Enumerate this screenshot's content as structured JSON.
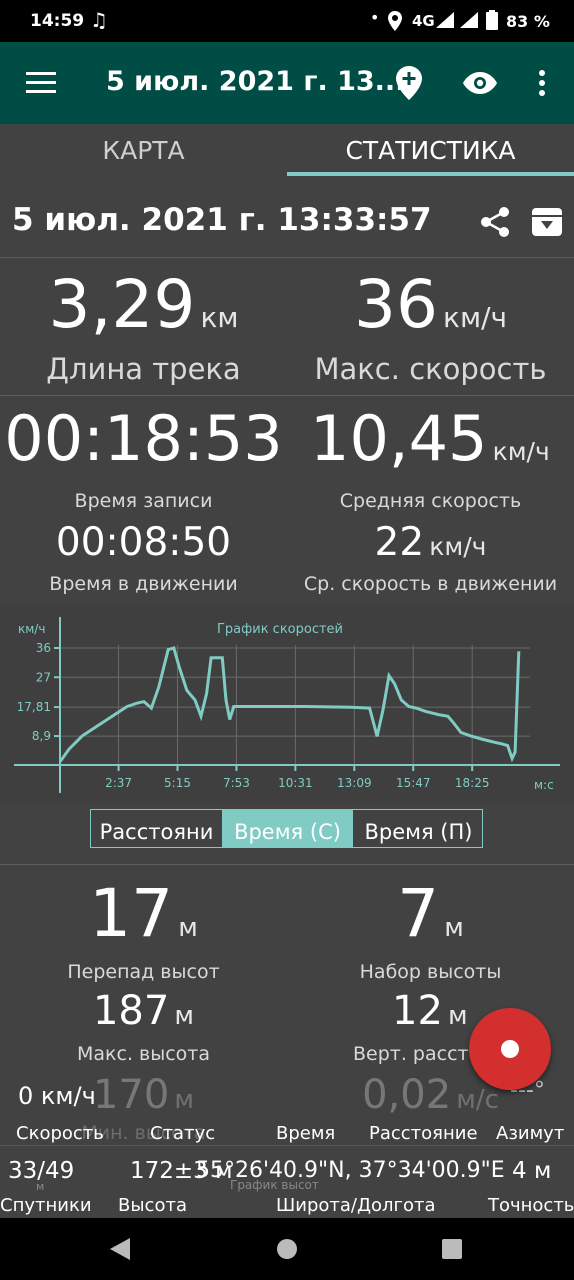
{
  "status_bar": {
    "time": "14:59",
    "network": "4G",
    "battery": "83 %"
  },
  "toolbar": {
    "title": "5 июл. 2021 г. 13..."
  },
  "tabs": [
    {
      "label": "КАРТА",
      "active": false
    },
    {
      "label": "СТАТИСТИКА",
      "active": true
    }
  ],
  "track": {
    "title": "5 июл. 2021 г. 13:33:57"
  },
  "stats": {
    "length": {
      "value": "3,29",
      "unit": "км",
      "label": "Длина трека"
    },
    "max_speed": {
      "value": "36",
      "unit": "км/ч",
      "label": "Макс. скорость"
    },
    "record_time": {
      "value": "00:18:53",
      "label": "Время записи"
    },
    "avg_speed": {
      "value": "10,45",
      "unit": "км/ч",
      "label": "Средняя скорость"
    },
    "moving_time": {
      "value": "00:08:50",
      "label": "Время в движении"
    },
    "moving_avg_speed": {
      "value": "22",
      "unit": "км/ч",
      "label": "Ср. скорость в движении"
    },
    "elev_diff": {
      "value": "17",
      "unit": "м",
      "label": "Перепад высот"
    },
    "elev_gain": {
      "value": "7",
      "unit": "м",
      "label": "Набор высоты"
    },
    "max_elev": {
      "value": "187",
      "unit": "м",
      "label": "Макс. высота"
    },
    "vert_dist": {
      "value": "12",
      "unit": "м",
      "label": "Верт. расстоя"
    },
    "min_elev": {
      "value": "170",
      "unit": "м",
      "label": "Мин. высота"
    },
    "dist_frac": {
      "value": "0,02",
      "unit": "м/с"
    }
  },
  "chart_data": {
    "type": "line",
    "title": "График скоростей",
    "ylabel": "км/ч",
    "xlabel": "м:с",
    "y_ticks": [
      "36",
      "27",
      "17,81",
      "8,9"
    ],
    "x_ticks": [
      "2:37",
      "5:15",
      "7:53",
      "10:31",
      "13:09",
      "15:47",
      "18:25"
    ],
    "ylim": [
      0,
      40
    ],
    "xlim_seconds": [
      0,
      1260
    ],
    "series": [
      {
        "color": "#80cbc4",
        "points": [
          [
            0,
            1
          ],
          [
            25,
            5
          ],
          [
            60,
            9
          ],
          [
            100,
            12
          ],
          [
            140,
            15
          ],
          [
            180,
            18
          ],
          [
            205,
            19
          ],
          [
            225,
            19.5
          ],
          [
            245,
            17.5
          ],
          [
            265,
            24
          ],
          [
            290,
            35.5
          ],
          [
            305,
            36
          ],
          [
            320,
            30
          ],
          [
            340,
            23
          ],
          [
            362,
            20
          ],
          [
            378,
            15
          ],
          [
            393,
            22
          ],
          [
            405,
            33
          ],
          [
            435,
            33
          ],
          [
            445,
            20
          ],
          [
            455,
            14
          ],
          [
            466,
            18
          ],
          [
            540,
            18
          ],
          [
            660,
            18
          ],
          [
            780,
            17.8
          ],
          [
            830,
            17.5
          ],
          [
            850,
            8.8
          ],
          [
            866,
            17
          ],
          [
            882,
            27.5
          ],
          [
            897,
            25
          ],
          [
            915,
            20
          ],
          [
            935,
            18
          ],
          [
            955,
            17.5
          ],
          [
            980,
            16.5
          ],
          [
            1015,
            15.5
          ],
          [
            1040,
            15
          ],
          [
            1055,
            13
          ],
          [
            1075,
            10
          ],
          [
            1100,
            9
          ],
          [
            1130,
            8
          ],
          [
            1165,
            7
          ],
          [
            1185,
            6.5
          ],
          [
            1200,
            6
          ],
          [
            1212,
            2
          ],
          [
            1220,
            4
          ],
          [
            1230,
            35
          ]
        ]
      }
    ],
    "grid": true
  },
  "chart_mode": {
    "options": [
      "Расстояни",
      "Время (С)",
      "Время (П)"
    ],
    "selected": 1
  },
  "bottom_bar": {
    "speed": {
      "value": "0 км/ч",
      "label": "Скорость"
    },
    "status": {
      "label": "Статус"
    },
    "time": {
      "label": "Время"
    },
    "distance": {
      "label": "Расстояние"
    },
    "azimuth": {
      "value": "---°",
      "label": "Азимут"
    },
    "satellites": {
      "value": "33/49",
      "label": "Спутники"
    },
    "altitude": {
      "value": "172±3 м",
      "label": "Высота"
    },
    "coords": {
      "value": "55°26'40.9\"N, 37°34'00.9\"E",
      "label": "Широта/Долгота"
    },
    "accuracy": {
      "value": "4 м",
      "label": "Точность"
    },
    "overlay_chart_title": "График высот",
    "overlay_unit": "м"
  },
  "colors": {
    "toolbar": "#004d45",
    "accent": "#80cbc4",
    "background": "#424242",
    "record_button": "#d32f2f"
  }
}
